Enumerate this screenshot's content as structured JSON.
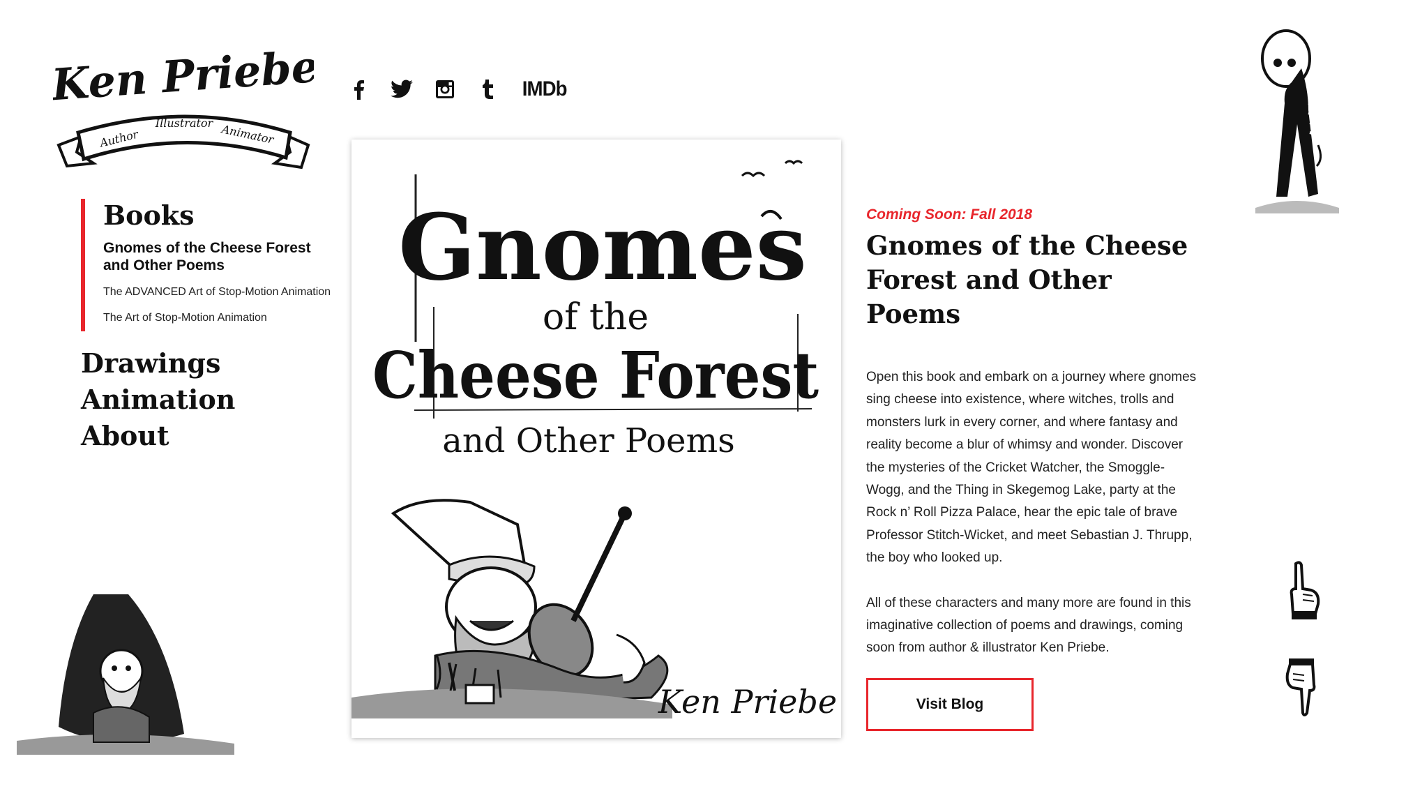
{
  "logo": {
    "name": "Ken Priebe",
    "tagline": [
      "Author",
      "Illustrator",
      "Animator"
    ]
  },
  "social": {
    "icons": [
      "facebook-icon",
      "twitter-icon",
      "instagram-icon",
      "tumblr-icon"
    ],
    "imdb_label": "IMDb"
  },
  "nav": {
    "books_label": "Books",
    "books_items": [
      "Gnomes of the Cheese Forest and Other Poems",
      "The ADVANCED Art of Stop-Motion Animation",
      "The Art of Stop-Motion Animation"
    ],
    "main_items": [
      "Drawings",
      "Animation",
      "About"
    ]
  },
  "cover": {
    "title_line1": "Gnomes",
    "title_line2": "of the",
    "title_line3": "Cheese Forest",
    "title_line4": "and Other Poems",
    "author": "Ken Priebe"
  },
  "book": {
    "coming_soon": "Coming Soon: Fall 2018",
    "title": "Gnomes of the Cheese Forest and Other Poems",
    "description_1": "Open this book and embark on a journey where gnomes sing cheese into existence, where witches, trolls and monsters lurk in every corner, and where fantasy and reality become a blur of whimsy and wonder. Discover the mysteries of the Cricket Watcher, the Smoggle-Wogg, and the Thing in Skegemog Lake, party at the Rock n’ Roll Pizza Palace, hear the epic tale of brave Professor Stitch-Wicket, and meet Sebastian J. Thrupp, the boy who looked up.",
    "description_2": "All of these characters and many more are found in this imaginative collection of poems and drawings, coming soon from author & illustrator Ken Priebe.",
    "button_label": "Visit Blog"
  },
  "colors": {
    "accent": "#e8262c",
    "text": "#111111",
    "background": "#ffffff"
  }
}
